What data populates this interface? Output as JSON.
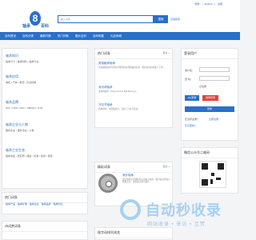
{
  "topbar": {
    "links": [
      "登录",
      "|",
      "English",
      "|",
      "注册"
    ]
  },
  "header": {
    "logo_left": "轴承",
    "logo_right": "百科",
    "search_placeholder": "输入词条",
    "search_button": "搜索",
    "advanced": "高级搜索"
  },
  "nav": {
    "items": [
      "百科首页",
      "百科分类",
      "最新词条",
      "热门词条",
      "图片百科",
      "百科明星",
      "礼品商城"
    ]
  },
  "categories": [
    {
      "title": "轴承知识",
      "links": "轴承尺寸 • 轴承材料 • 轴承行业"
    },
    {
      "title": "轴承应用",
      "links": "电机 • 汽车 • 机床 • 农业机械"
    },
    {
      "title": "轴承品牌",
      "links": "SKF • NSK • FAG • TIMKEN • NTN"
    },
    {
      "title": "轴承企业与人物",
      "links": "国内企业 • 国外企业 • 人物"
    },
    {
      "title": "轴承工业生态",
      "links": "轴承协会 • 研究所 • 展会 • 标准 • 检测 • 贸易"
    }
  ],
  "hot_entries": {
    "title": "热门词条",
    "more": "更多 »",
    "items": [
      {
        "title": "角接触球轴承",
        "desc": "角接触球轴承可同时承受径向负荷和轴向负荷，能在较高的转速下工作。"
      },
      {
        "title": "深沟球轴承",
        "desc": "深沟球轴承（Deep Groove Ball Bearing）。"
      },
      {
        "title": "万向节轴承",
        "desc": "结构简单，承受载荷大，适用于万向节连接。"
      }
    ]
  },
  "pic_entries": {
    "title": "精彩词条",
    "more": "更多 »",
    "item_title": "滚针轴承",
    "item_desc": "滚针轴承是带圆柱滚子的滚子轴承，相对其直径滚子既细又长，这种滚子称为滚针。"
  },
  "login": {
    "title": "登录用户",
    "user_label": "用户名：",
    "pass_label": "密 码：",
    "remember": "记住我",
    "login_button": "登录",
    "qq_button": "QQ登录",
    "weibo_button": "微博登录",
    "register": "还没有注册？",
    "forgot": "忘记密码？",
    "register_link": "立即注册"
  },
  "wechat": {
    "title": "微信公众号二维码"
  },
  "hot_tags": {
    "title": "热门词条",
    "tags": [
      "轴承产品",
      "轴承标准",
      "轴承企业",
      "轴承品牌",
      "轴承知识"
    ]
  },
  "poetry": {
    "title": "诗词赏词条"
  },
  "letters": {
    "title": "按字母排列浏览"
  },
  "watermark": {
    "text": "自动秒收录",
    "sub": "网站收录 • 来访 • 互赞"
  },
  "colors": {
    "accent": "#2a6fc9",
    "danger": "#e0433a"
  }
}
